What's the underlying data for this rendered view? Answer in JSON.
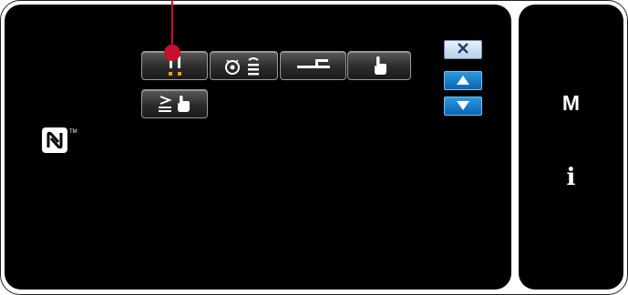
{
  "buttons": {
    "row1": [
      {
        "icon": "thread-trimmer-icon"
      },
      {
        "icon": "bobbin-counter-icon"
      },
      {
        "icon": "presser-foot-icon"
      },
      {
        "icon": "touch-hand-icon"
      }
    ],
    "row2": [
      {
        "icon": "stitch-adjust-touch-icon"
      }
    ]
  },
  "nav": {
    "close_icon": "close-icon",
    "up_icon": "arrow-up-icon",
    "down_icon": "arrow-down-icon"
  },
  "logo": {
    "icon": "nfc-n-mark-icon",
    "text": "N"
  },
  "side": {
    "mode_label": "M",
    "info_label": "i"
  },
  "colors": {
    "panel": "#000000",
    "callout": "#c8102e",
    "nav_blue": "#0a64b0",
    "accent_orange": "#f2a100"
  }
}
